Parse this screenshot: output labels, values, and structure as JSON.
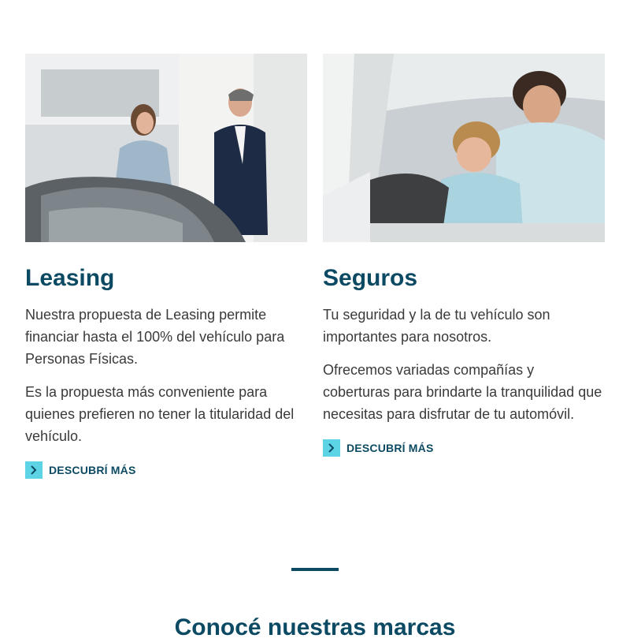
{
  "cards": [
    {
      "image_alt": "Pareja conversando en concesionario",
      "title": "Leasing",
      "paragraphs": [
        "Nuestra propuesta de Leasing permite financiar hasta el 100% del vehículo para Personas Físicas.",
        "Es la propuesta más conveniente para quienes prefieren no tener la titularidad del vehículo."
      ],
      "cta": "DESCUBRÍ MÁS"
    },
    {
      "image_alt": "Padre e hijo dentro de un auto",
      "title": "Seguros",
      "paragraphs": [
        "Tu seguridad y la de tu vehículo son importantes para nosotros.",
        "Ofrecemos variadas compañías y coberturas para brindarte la tranquilidad que necesitas para disfrutar de tu automóvil."
      ],
      "cta": "DESCUBRÍ MÁS"
    }
  ],
  "brands_section": {
    "title": "Conocé nuestras marcas"
  },
  "colors": {
    "title": "#0c4a63",
    "accent": "#5dd3e6",
    "text": "#3a3a3a"
  },
  "icons": {
    "cta": "chevron-right-icon"
  }
}
